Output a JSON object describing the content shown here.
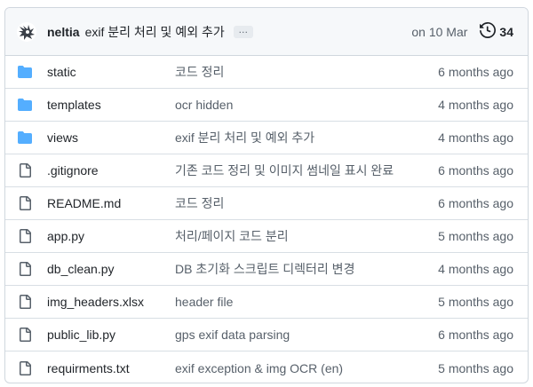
{
  "commit": {
    "author": "neltia",
    "message": "exif 분리 처리 및 예외 추가",
    "ellipsis": "…",
    "date": "on 10 Mar",
    "history_count": "34"
  },
  "files": [
    {
      "type": "dir",
      "name": "static",
      "message": "코드 정리",
      "age": "6 months ago"
    },
    {
      "type": "dir",
      "name": "templates",
      "message": "ocr hidden",
      "age": "4 months ago"
    },
    {
      "type": "dir",
      "name": "views",
      "message": "exif 분리 처리 및 예외 추가",
      "age": "4 months ago"
    },
    {
      "type": "file",
      "name": ".gitignore",
      "message": "기존 코드 정리 및 이미지 썸네일 표시 완료",
      "age": "6 months ago"
    },
    {
      "type": "file",
      "name": "README.md",
      "message": "코드 정리",
      "age": "6 months ago"
    },
    {
      "type": "file",
      "name": "app.py",
      "message": "처리/페이지 코드 분리",
      "age": "5 months ago"
    },
    {
      "type": "file",
      "name": "db_clean.py",
      "message": "DB 초기화 스크립트 디렉터리 변경",
      "age": "4 months ago"
    },
    {
      "type": "file",
      "name": "img_headers.xlsx",
      "message": "header file",
      "age": "5 months ago"
    },
    {
      "type": "file",
      "name": "public_lib.py",
      "message": "gps exif data parsing",
      "age": "6 months ago"
    },
    {
      "type": "file",
      "name": "requirments.txt",
      "message": "exif exception & img OCR (en)",
      "age": "5 months ago"
    }
  ],
  "colors": {
    "folder": "#54aeff",
    "file_icon": "#57606a",
    "muted_text": "#57606a",
    "border": "#d0d7de",
    "header_bg": "#f6f8fa"
  },
  "icons": {
    "avatar": "author-avatar",
    "folder": "folder-icon",
    "file": "file-icon",
    "history": "history-clock-icon"
  }
}
